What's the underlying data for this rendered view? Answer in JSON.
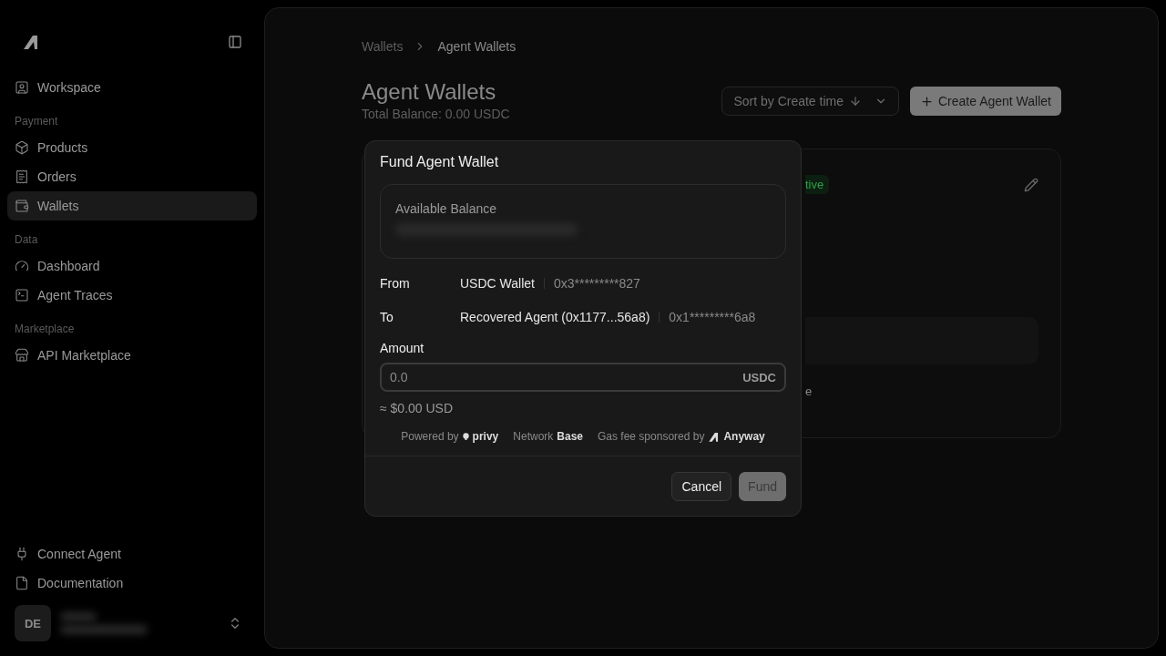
{
  "sidebar": {
    "sections": [
      {
        "items": [
          {
            "label": "Workspace",
            "selected": false
          }
        ]
      },
      {
        "title": "Payment",
        "items": [
          {
            "label": "Products",
            "selected": false
          },
          {
            "label": "Orders",
            "selected": false
          },
          {
            "label": "Wallets",
            "selected": true
          }
        ]
      },
      {
        "title": "Data",
        "items": [
          {
            "label": "Dashboard",
            "selected": false
          },
          {
            "label": "Agent Traces",
            "selected": false
          }
        ]
      },
      {
        "title": "Marketplace",
        "items": [
          {
            "label": "API Marketplace",
            "selected": false
          }
        ]
      }
    ],
    "footer_links": [
      {
        "label": "Connect Agent"
      },
      {
        "label": "Documentation"
      }
    ],
    "user": {
      "initials": "DE"
    }
  },
  "breadcrumb": [
    "Wallets",
    "Agent Wallets"
  ],
  "page": {
    "title": "Agent Wallets",
    "subtitle": "Total Balance: 0.00 USDC",
    "sort": "Sort by Create time",
    "create_button": "Create Agent Wallet"
  },
  "wallet_card": {
    "status": "tive",
    "footer_text": "e"
  },
  "dialog": {
    "title": "Fund Agent Wallet",
    "balance_label": "Available Balance",
    "rows": [
      {
        "label": "From",
        "name": "USDC Wallet",
        "address": "0x3*********827"
      },
      {
        "label": "To",
        "name": "Recovered Agent (0x1177...56a8)",
        "address": "0x1*********6a8"
      }
    ],
    "amount_label": "Amount",
    "amount_placeholder": "0.0",
    "currency": "USDC",
    "usd_value": "≈ $0.00 USD",
    "powered_by": "Powered by",
    "privy": "privy",
    "network_label": "Network",
    "network": "Base",
    "gas_label": "Gas fee sponsored by",
    "sponsor": "Anyway",
    "cancel": "Cancel",
    "fund": "Fund",
    "fund_disabled": true
  }
}
